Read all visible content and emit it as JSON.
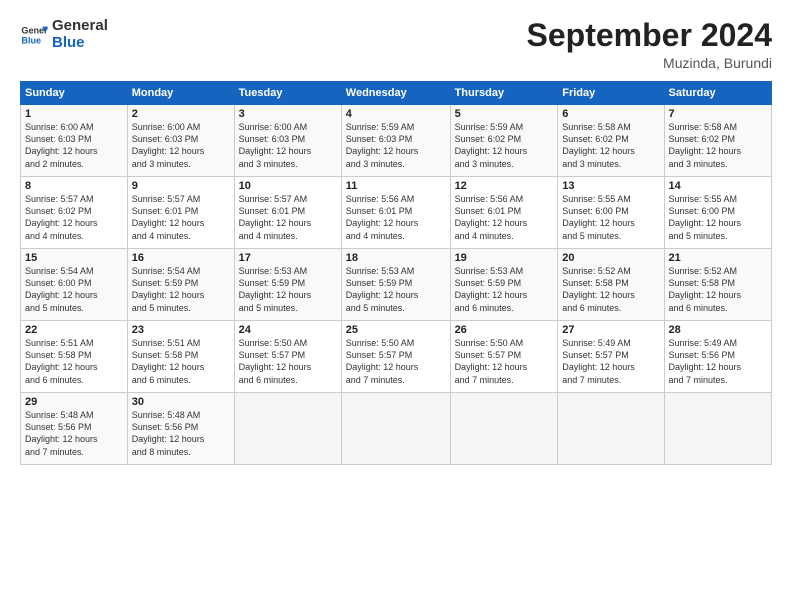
{
  "header": {
    "logo_general": "General",
    "logo_blue": "Blue",
    "month_title": "September 2024",
    "location": "Muzinda, Burundi"
  },
  "days_of_week": [
    "Sunday",
    "Monday",
    "Tuesday",
    "Wednesday",
    "Thursday",
    "Friday",
    "Saturday"
  ],
  "weeks": [
    [
      {
        "day": "1",
        "sunrise": "6:00 AM",
        "sunset": "6:03 PM",
        "daylight": "12 hours and 2 minutes."
      },
      {
        "day": "2",
        "sunrise": "6:00 AM",
        "sunset": "6:03 PM",
        "daylight": "12 hours and 3 minutes."
      },
      {
        "day": "3",
        "sunrise": "6:00 AM",
        "sunset": "6:03 PM",
        "daylight": "12 hours and 3 minutes."
      },
      {
        "day": "4",
        "sunrise": "5:59 AM",
        "sunset": "6:03 PM",
        "daylight": "12 hours and 3 minutes."
      },
      {
        "day": "5",
        "sunrise": "5:59 AM",
        "sunset": "6:02 PM",
        "daylight": "12 hours and 3 minutes."
      },
      {
        "day": "6",
        "sunrise": "5:58 AM",
        "sunset": "6:02 PM",
        "daylight": "12 hours and 3 minutes."
      },
      {
        "day": "7",
        "sunrise": "5:58 AM",
        "sunset": "6:02 PM",
        "daylight": "12 hours and 3 minutes."
      }
    ],
    [
      {
        "day": "8",
        "sunrise": "5:57 AM",
        "sunset": "6:02 PM",
        "daylight": "12 hours and 4 minutes."
      },
      {
        "day": "9",
        "sunrise": "5:57 AM",
        "sunset": "6:01 PM",
        "daylight": "12 hours and 4 minutes."
      },
      {
        "day": "10",
        "sunrise": "5:57 AM",
        "sunset": "6:01 PM",
        "daylight": "12 hours and 4 minutes."
      },
      {
        "day": "11",
        "sunrise": "5:56 AM",
        "sunset": "6:01 PM",
        "daylight": "12 hours and 4 minutes."
      },
      {
        "day": "12",
        "sunrise": "5:56 AM",
        "sunset": "6:01 PM",
        "daylight": "12 hours and 4 minutes."
      },
      {
        "day": "13",
        "sunrise": "5:55 AM",
        "sunset": "6:00 PM",
        "daylight": "12 hours and 5 minutes."
      },
      {
        "day": "14",
        "sunrise": "5:55 AM",
        "sunset": "6:00 PM",
        "daylight": "12 hours and 5 minutes."
      }
    ],
    [
      {
        "day": "15",
        "sunrise": "5:54 AM",
        "sunset": "6:00 PM",
        "daylight": "12 hours and 5 minutes."
      },
      {
        "day": "16",
        "sunrise": "5:54 AM",
        "sunset": "5:59 PM",
        "daylight": "12 hours and 5 minutes."
      },
      {
        "day": "17",
        "sunrise": "5:53 AM",
        "sunset": "5:59 PM",
        "daylight": "12 hours and 5 minutes."
      },
      {
        "day": "18",
        "sunrise": "5:53 AM",
        "sunset": "5:59 PM",
        "daylight": "12 hours and 5 minutes."
      },
      {
        "day": "19",
        "sunrise": "5:53 AM",
        "sunset": "5:59 PM",
        "daylight": "12 hours and 6 minutes."
      },
      {
        "day": "20",
        "sunrise": "5:52 AM",
        "sunset": "5:58 PM",
        "daylight": "12 hours and 6 minutes."
      },
      {
        "day": "21",
        "sunrise": "5:52 AM",
        "sunset": "5:58 PM",
        "daylight": "12 hours and 6 minutes."
      }
    ],
    [
      {
        "day": "22",
        "sunrise": "5:51 AM",
        "sunset": "5:58 PM",
        "daylight": "12 hours and 6 minutes."
      },
      {
        "day": "23",
        "sunrise": "5:51 AM",
        "sunset": "5:58 PM",
        "daylight": "12 hours and 6 minutes."
      },
      {
        "day": "24",
        "sunrise": "5:50 AM",
        "sunset": "5:57 PM",
        "daylight": "12 hours and 6 minutes."
      },
      {
        "day": "25",
        "sunrise": "5:50 AM",
        "sunset": "5:57 PM",
        "daylight": "12 hours and 7 minutes."
      },
      {
        "day": "26",
        "sunrise": "5:50 AM",
        "sunset": "5:57 PM",
        "daylight": "12 hours and 7 minutes."
      },
      {
        "day": "27",
        "sunrise": "5:49 AM",
        "sunset": "5:57 PM",
        "daylight": "12 hours and 7 minutes."
      },
      {
        "day": "28",
        "sunrise": "5:49 AM",
        "sunset": "5:56 PM",
        "daylight": "12 hours and 7 minutes."
      }
    ],
    [
      {
        "day": "29",
        "sunrise": "5:48 AM",
        "sunset": "5:56 PM",
        "daylight": "12 hours and 7 minutes."
      },
      {
        "day": "30",
        "sunrise": "5:48 AM",
        "sunset": "5:56 PM",
        "daylight": "12 hours and 8 minutes."
      },
      null,
      null,
      null,
      null,
      null
    ]
  ],
  "labels": {
    "sunrise": "Sunrise:",
    "sunset": "Sunset:",
    "daylight": "Daylight:"
  }
}
